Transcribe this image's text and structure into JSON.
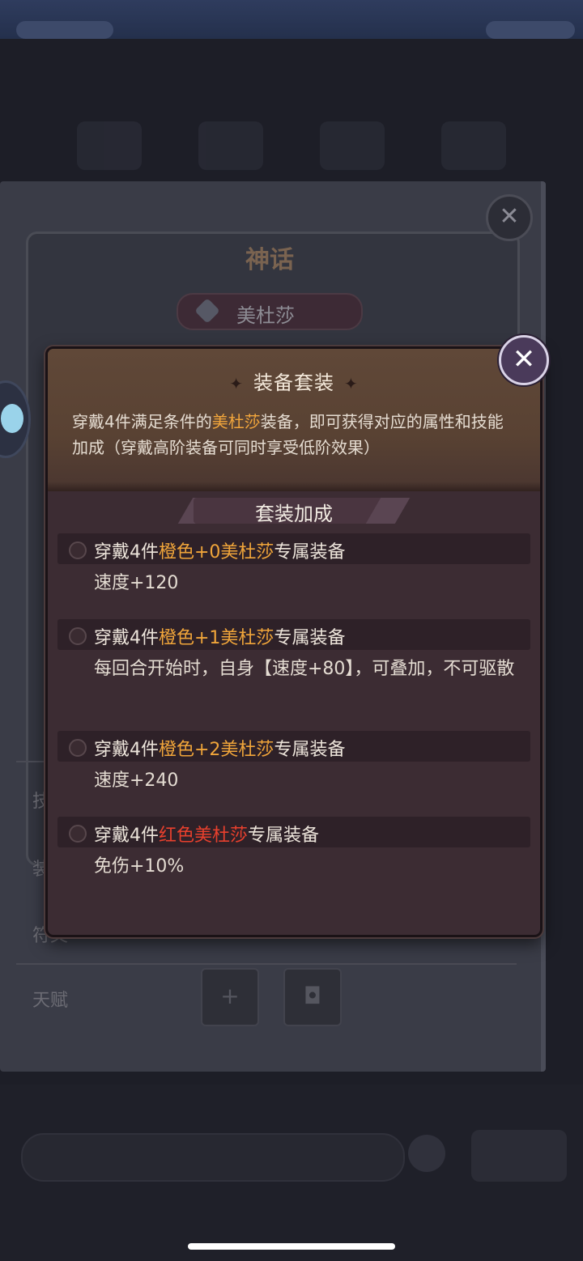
{
  "background": {
    "myth_badge": "神话",
    "hero_name": "美杜莎",
    "labels": [
      "技",
      "装",
      "符文",
      "天赋"
    ],
    "talent_add": "+"
  },
  "dialog": {
    "title": "装备套装",
    "desc_prefix": "穿戴4件满足条件的",
    "desc_highlight": "美杜莎",
    "desc_suffix": "装备，即可获得对应的属性和技能加成（穿戴高阶装备可同时享受低阶效果）",
    "bonus_header": "套装加成",
    "close_glyph": "✕",
    "tiers": [
      {
        "prefix": "穿戴4件",
        "highlight": "橙色+0美杜莎",
        "highlight_color": "orange",
        "suffix": "专属装备",
        "effect": "速度+120"
      },
      {
        "prefix": "穿戴4件",
        "highlight": "橙色+1美杜莎",
        "highlight_color": "orange",
        "suffix": "专属装备",
        "effect": "每回合开始时，自身【速度+80】，可叠加，不可驱散"
      },
      {
        "prefix": "穿戴4件",
        "highlight": "橙色+2美杜莎",
        "highlight_color": "orange",
        "suffix": "专属装备",
        "effect": "速度+240"
      },
      {
        "prefix": "穿戴4件",
        "highlight": "红色美杜莎",
        "highlight_color": "red",
        "suffix": "专属装备",
        "effect": "免伤+10%"
      }
    ]
  },
  "colors": {
    "orange": "#f0a53a",
    "red": "#e8402d"
  }
}
